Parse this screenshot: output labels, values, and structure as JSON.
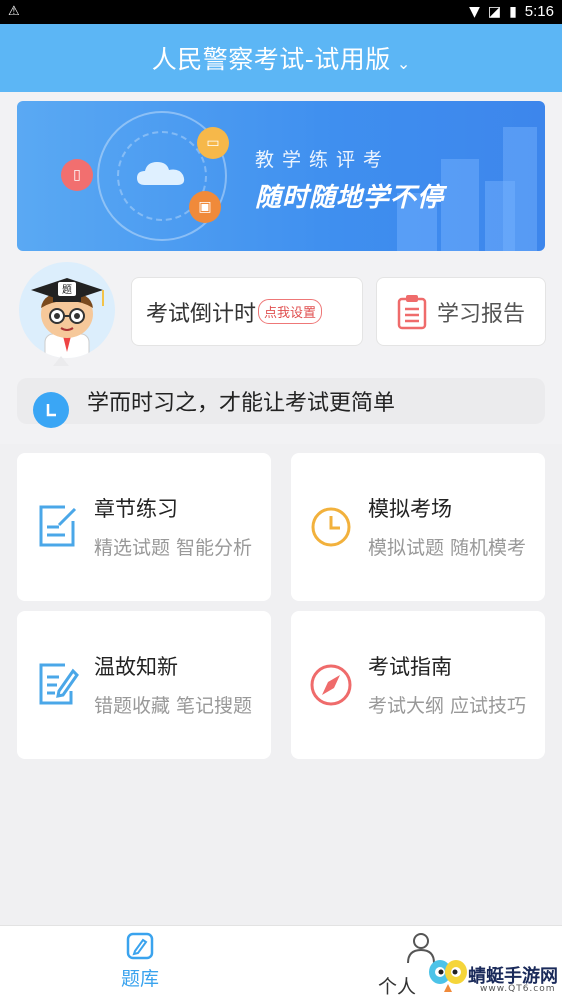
{
  "status_bar": {
    "time": "5:16"
  },
  "header": {
    "title": "人民警察考试-试用版",
    "dropdown_icon": "chevron-down-icon"
  },
  "banner": {
    "tagline_small": "教学练评考",
    "tagline_big": "随时随地学不停"
  },
  "countdown": {
    "label": "考试倒计时",
    "set_label": "点我设置"
  },
  "report": {
    "label": "学习报告"
  },
  "motto": {
    "text": "学而时习之，才能让考试更简单"
  },
  "tiles": [
    {
      "title": "章节练习",
      "subtitle": "精选试题 智能分析",
      "icon": "chapter-icon",
      "color": "#4aa7e8"
    },
    {
      "title": "模拟考场",
      "subtitle": "模拟试题 随机模考",
      "icon": "clock-icon",
      "color": "#f2b13c"
    },
    {
      "title": "温故知新",
      "subtitle": "错题收藏 笔记搜题",
      "icon": "notes-icon",
      "color": "#4aa7e8"
    },
    {
      "title": "考试指南",
      "subtitle": "考试大纲 应试技巧",
      "icon": "compass-icon",
      "color": "#ef6b6b"
    }
  ],
  "nav": {
    "bank_label": "题库",
    "me_label": "个人"
  },
  "watermark": {
    "text": "蜻蜓手游网",
    "sub": "www.QT6.com"
  },
  "colors": {
    "accent": "#5cb6f5",
    "nav_active": "#3aa3ee"
  }
}
